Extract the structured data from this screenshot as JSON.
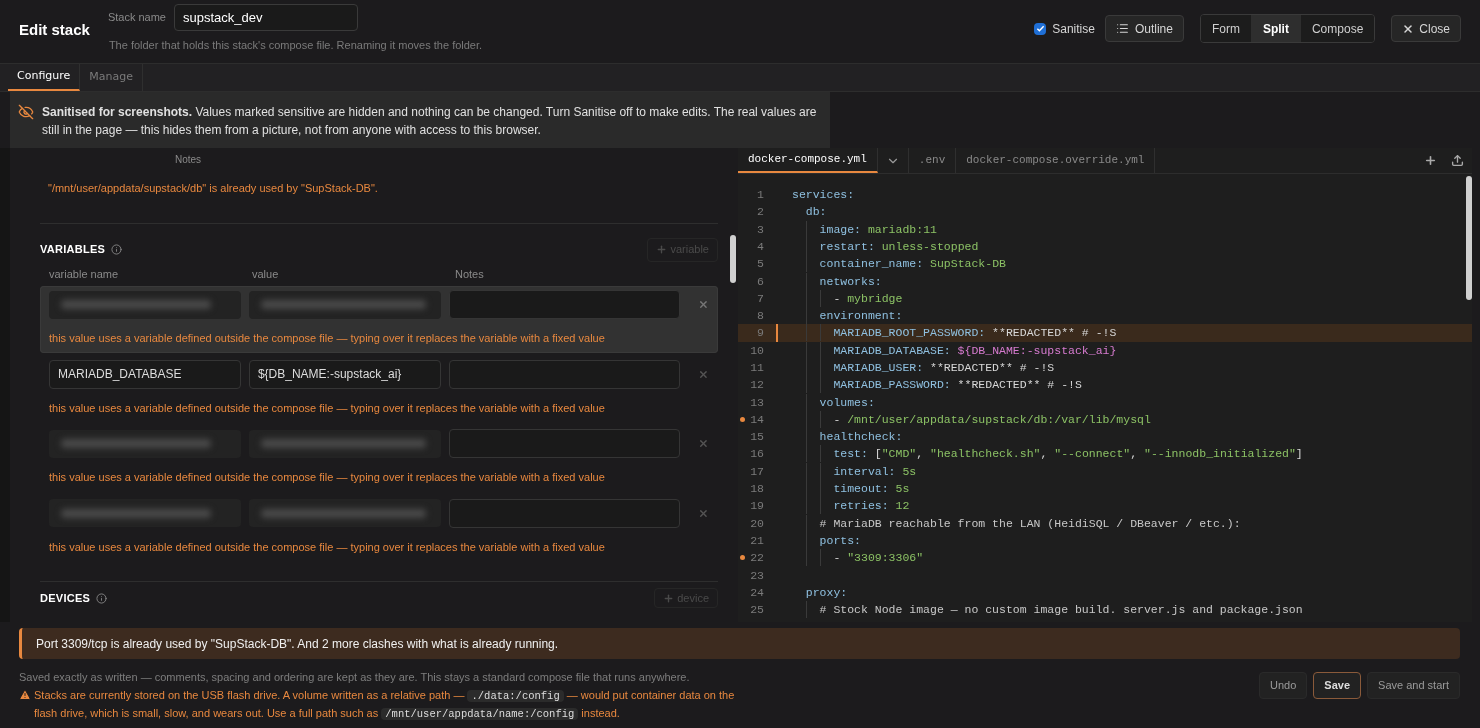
{
  "header": {
    "title": "Edit stack",
    "stack_name": {
      "label": "Stack name",
      "value": "supstack_dev",
      "hint": "The folder that holds this stack's compose file. Renaming it moves the folder."
    },
    "sanitise": {
      "label": "Sanitise",
      "checked": true
    },
    "outline_button": "Outline",
    "view_modes": [
      {
        "label": "Form",
        "selected": false
      },
      {
        "label": "Split",
        "selected": true
      },
      {
        "label": "Compose",
        "selected": false
      }
    ],
    "close_button": "Close"
  },
  "tabs": [
    {
      "label": "Configure",
      "selected": true
    },
    {
      "label": "Manage",
      "selected": false
    }
  ],
  "banner": {
    "text": "**Sanitised for screenshots.** Values marked sensitive are hidden and nothing can be changed. Turn Sanitise off to make edits. The real values are still in the page — this hides them from a picture, not from anyone with access to this browser."
  },
  "left_pane": {
    "notes_header": "Notes",
    "path_warning": "\"/mnt/user/appdata/supstack/db\" is already used by \"SupStack-DB\".",
    "variables": {
      "title": "VARIABLES",
      "add_button": {
        "label": "variable",
        "disabled": true
      },
      "columns": [
        "variable name",
        "value",
        "Notes"
      ],
      "rows": [
        {
          "sanitised": true,
          "highlighted": true,
          "warning": "this value uses a variable defined outside the compose file — typing over it replaces the variable with a fixed value"
        },
        {
          "sanitised": false,
          "highlighted": false,
          "name": "MARIADB_DATABASE",
          "value": "${DB_NAME:-supstack_ai}",
          "warning": "this value uses a variable defined outside the compose file — typing over it replaces the variable with a fixed value"
        },
        {
          "sanitised": true,
          "highlighted": false,
          "warning": "this value uses a variable defined outside the compose file — typing over it replaces the variable with a fixed value"
        },
        {
          "sanitised": true,
          "highlighted": false,
          "warning": "this value uses a variable defined outside the compose file — typing over it replaces the variable with a fixed value"
        }
      ]
    },
    "devices": {
      "title": "DEVICES",
      "add_button": {
        "label": "device",
        "disabled": true
      }
    }
  },
  "editor": {
    "tabs": [
      {
        "label": "docker-compose.yml",
        "selected": true
      },
      {
        "label": ".env",
        "selected": false
      },
      {
        "label": "docker-compose.override.yml",
        "selected": false
      }
    ],
    "lines": [
      {
        "number": "1",
        "highlighted": false,
        "marked": false,
        "segments": [
          {
            "kind": "key",
            "text": "services:"
          }
        ]
      },
      {
        "number": "2",
        "highlighted": false,
        "marked": false,
        "segments": [
          {
            "kind": "key",
            "text": "  db:"
          }
        ]
      },
      {
        "number": "3",
        "highlighted": false,
        "marked": false,
        "segments": [
          {
            "kind": "key",
            "text": "    image:"
          },
          {
            "kind": "value",
            "text": " mariadb:11"
          }
        ]
      },
      {
        "number": "4",
        "highlighted": false,
        "marked": false,
        "segments": [
          {
            "kind": "key",
            "text": "    restart:"
          },
          {
            "kind": "value",
            "text": " unless-stopped"
          }
        ]
      },
      {
        "number": "5",
        "highlighted": false,
        "marked": false,
        "segments": [
          {
            "kind": "key",
            "text": "    container_name:"
          },
          {
            "kind": "value",
            "text": " SupStack-DB"
          }
        ]
      },
      {
        "number": "6",
        "highlighted": false,
        "marked": false,
        "segments": [
          {
            "kind": "key",
            "text": "    networks:"
          }
        ]
      },
      {
        "number": "7",
        "highlighted": false,
        "marked": false,
        "segments": [
          {
            "kind": "plain",
            "text": "      - "
          },
          {
            "kind": "value",
            "text": "mybridge"
          }
        ]
      },
      {
        "number": "8",
        "highlighted": false,
        "marked": false,
        "segments": [
          {
            "kind": "key",
            "text": "    environment:"
          }
        ]
      },
      {
        "number": "9",
        "highlighted": true,
        "marked": false,
        "segments": [
          {
            "kind": "key",
            "text": "      MARIADB_ROOT_PASSWORD:"
          },
          {
            "kind": "plain",
            "text": " **REDACTED** # -!S"
          }
        ]
      },
      {
        "number": "10",
        "highlighted": false,
        "marked": false,
        "segments": [
          {
            "kind": "key",
            "text": "      MARIADB_DATABASE:"
          },
          {
            "kind": "var",
            "text": " ${DB_NAME:-supstack_ai}"
          }
        ]
      },
      {
        "number": "11",
        "highlighted": false,
        "marked": false,
        "segments": [
          {
            "kind": "key",
            "text": "      MARIADB_USER:"
          },
          {
            "kind": "plain",
            "text": " **REDACTED** # -!S"
          }
        ]
      },
      {
        "number": "12",
        "highlighted": false,
        "marked": false,
        "segments": [
          {
            "kind": "key",
            "text": "      MARIADB_PASSWORD:"
          },
          {
            "kind": "plain",
            "text": " **REDACTED** # -!S"
          }
        ]
      },
      {
        "number": "13",
        "highlighted": false,
        "marked": false,
        "segments": [
          {
            "kind": "key",
            "text": "    volumes:"
          }
        ]
      },
      {
        "number": "14",
        "highlighted": false,
        "marked": true,
        "segments": [
          {
            "kind": "plain",
            "text": "      - "
          },
          {
            "kind": "value",
            "text": "/mnt/user/appdata/supstack/db:/var/lib/mysql"
          }
        ]
      },
      {
        "number": "15",
        "highlighted": false,
        "marked": false,
        "segments": [
          {
            "kind": "key",
            "text": "    healthcheck:"
          }
        ]
      },
      {
        "number": "16",
        "highlighted": false,
        "marked": false,
        "segments": [
          {
            "kind": "key",
            "text": "      test:"
          },
          {
            "kind": "plain",
            "text": " ["
          },
          {
            "kind": "value",
            "text": "\"CMD\""
          },
          {
            "kind": "plain",
            "text": ", "
          },
          {
            "kind": "value",
            "text": "\"healthcheck.sh\""
          },
          {
            "kind": "plain",
            "text": ", "
          },
          {
            "kind": "value",
            "text": "\"--connect\""
          },
          {
            "kind": "plain",
            "text": ", "
          },
          {
            "kind": "value",
            "text": "\"--innodb_initialized\""
          },
          {
            "kind": "plain",
            "text": "]"
          }
        ]
      },
      {
        "number": "17",
        "highlighted": false,
        "marked": false,
        "segments": [
          {
            "kind": "key",
            "text": "      interval:"
          },
          {
            "kind": "value",
            "text": " 5s"
          }
        ]
      },
      {
        "number": "18",
        "highlighted": false,
        "marked": false,
        "segments": [
          {
            "kind": "key",
            "text": "      timeout:"
          },
          {
            "kind": "value",
            "text": " 5s"
          }
        ]
      },
      {
        "number": "19",
        "highlighted": false,
        "marked": false,
        "segments": [
          {
            "kind": "key",
            "text": "      retries:"
          },
          {
            "kind": "value",
            "text": " 12"
          }
        ]
      },
      {
        "number": "20",
        "highlighted": false,
        "marked": false,
        "segments": [
          {
            "kind": "comment",
            "text": "    # MariaDB reachable from the LAN (HeidiSQL / DBeaver / etc.):"
          }
        ]
      },
      {
        "number": "21",
        "highlighted": false,
        "marked": false,
        "segments": [
          {
            "kind": "key",
            "text": "    ports:"
          }
        ]
      },
      {
        "number": "22",
        "highlighted": false,
        "marked": true,
        "segments": [
          {
            "kind": "plain",
            "text": "      - "
          },
          {
            "kind": "value",
            "text": "\"3309:3306\""
          }
        ]
      },
      {
        "number": "23",
        "highlighted": false,
        "marked": false
      },
      {
        "number": "24",
        "highlighted": false,
        "marked": false,
        "segments": [
          {
            "kind": "key",
            "text": "  proxy:"
          }
        ]
      },
      {
        "number": "25",
        "highlighted": false,
        "marked": false,
        "segments": [
          {
            "kind": "comment",
            "text": "    # Stock Node image — no custom image build. server.js and package.json"
          }
        ]
      }
    ]
  },
  "footer": {
    "clash_warning": "Port 3309/tcp is already used by \"SupStack-DB\". And 2 more clashes with what is already running.",
    "note": "Saved exactly as written — comments, spacing and ordering are kept as they are. This stays a standard compose file that runs anywhere.",
    "flash_warning": [
      {
        "kind": "text",
        "text": "Stacks are currently stored on the USB flash drive. A volume written as a relative path — "
      },
      {
        "kind": "code",
        "text": "./data:/config"
      },
      {
        "kind": "text",
        "text": " — would put container data on the flash drive, which is small, slow, and wears out. Use a full path such as "
      },
      {
        "kind": "code",
        "text": "/mnt/user/appdata/name:/config"
      },
      {
        "kind": "text",
        "text": " instead."
      }
    ],
    "buttons": [
      {
        "label": "Undo",
        "kind": "secondary"
      },
      {
        "label": "Save",
        "kind": "primary"
      },
      {
        "label": "Save and start",
        "kind": "secondary"
      }
    ]
  }
}
